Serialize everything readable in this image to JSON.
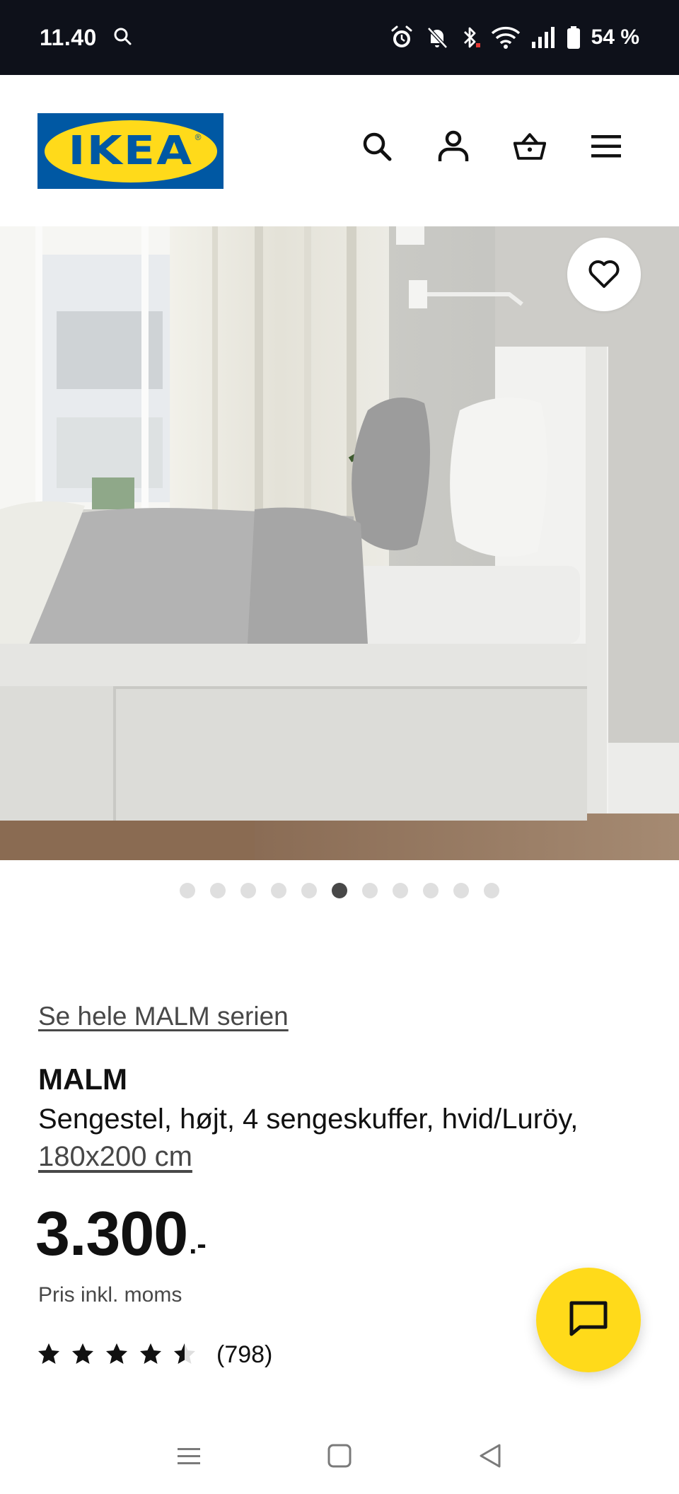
{
  "status_bar": {
    "time": "11.40",
    "battery": "54 %",
    "icons": [
      "search-icon",
      "alarm-icon",
      "bell-off-icon",
      "bluetooth-icon",
      "wifi-icon",
      "signal-icon",
      "battery-icon"
    ]
  },
  "header": {
    "logo_text": "IKEA",
    "logo_colors": {
      "background": "#0058a3",
      "oval": "#ffda1a"
    },
    "icons": [
      "search-icon",
      "account-icon",
      "basket-icon",
      "menu-icon"
    ]
  },
  "gallery": {
    "dot_count": 11,
    "active_index": 5,
    "favorite_icon": "heart-icon"
  },
  "product": {
    "series_link": "Se hele MALM serien",
    "name": "MALM",
    "description": "Sengestel, højt, 4 sengeskuffer, hvid/Luröy,",
    "size": "180x200 cm",
    "price": "3.300",
    "price_suffix": ".-",
    "price_note": "Pris inkl. moms",
    "rating": 4.5,
    "rating_max": 5,
    "review_count": "(798)"
  },
  "chat": {
    "icon": "chat-icon",
    "color": "#ffda1a"
  },
  "nav_bar": {
    "icons": [
      "recents-icon",
      "home-icon",
      "back-icon"
    ]
  }
}
